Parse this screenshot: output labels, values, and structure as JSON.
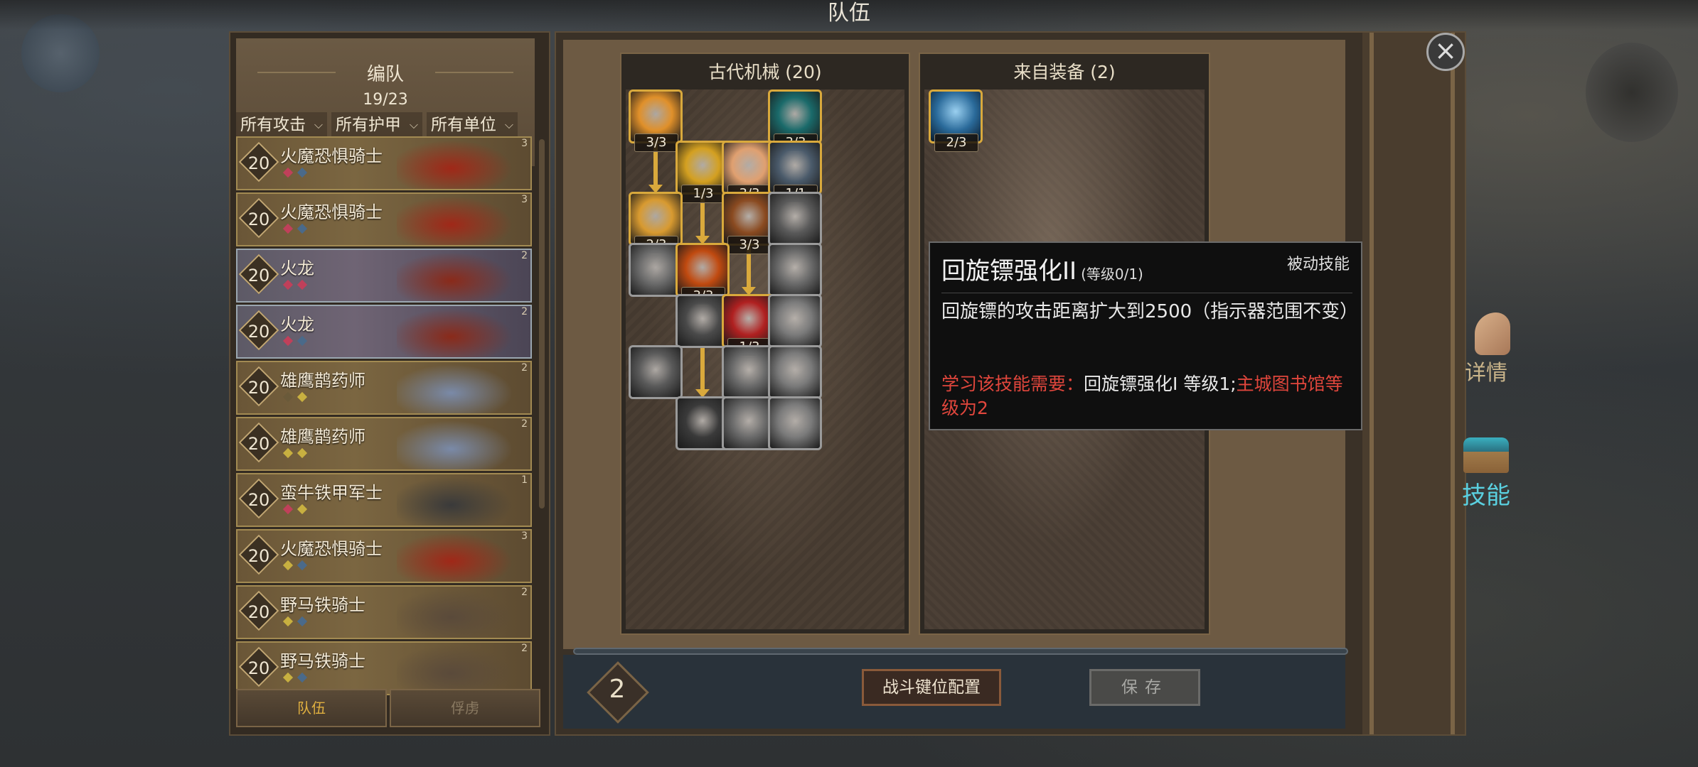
{
  "window_title": "队伍",
  "formation": {
    "title": "编队",
    "count": "19/23",
    "filters": [
      "所有攻击",
      "所有护甲",
      "所有单位"
    ]
  },
  "units": [
    {
      "level": "20",
      "name": "火魔恐惧骑士",
      "count": "3",
      "type": "knight",
      "gems": [
        "#c0405a",
        "#4a6a8a"
      ]
    },
    {
      "level": "20",
      "name": "火魔恐惧骑士",
      "count": "3",
      "type": "knight",
      "gems": [
        "#c0405a",
        "#4a6a8a"
      ]
    },
    {
      "level": "20",
      "name": "火龙",
      "count": "2",
      "type": "dragon",
      "gems": [
        "#c0405a",
        "#c0405a"
      ]
    },
    {
      "level": "20",
      "name": "火龙",
      "count": "2",
      "type": "dragon",
      "gems": [
        "#c0405a",
        "#4a6a8a"
      ]
    },
    {
      "level": "20",
      "name": "雄鹰鹊药师",
      "count": "2",
      "type": "healer",
      "gems": [
        "#6a5a3a",
        "#c8b040"
      ]
    },
    {
      "level": "20",
      "name": "雄鹰鹊药师",
      "count": "2",
      "type": "healer",
      "gems": [
        "#c8b040",
        "#c8b040"
      ]
    },
    {
      "level": "20",
      "name": "蛮牛铁甲军士",
      "count": "1",
      "type": "soldier",
      "gems": [
        "#c0405a",
        "#c8b040"
      ]
    },
    {
      "level": "20",
      "name": "火魔恐惧骑士",
      "count": "3",
      "type": "knight",
      "gems": [
        "#c8b040",
        "#4a6a8a"
      ]
    },
    {
      "level": "20",
      "name": "野马铁骑士",
      "count": "2",
      "type": "rider",
      "gems": [
        "#c8b040",
        "#4a6a8a"
      ]
    },
    {
      "level": "20",
      "name": "野马铁骑士",
      "count": "2",
      "type": "rider",
      "gems": [
        "#c8b040",
        "#4a6a8a"
      ]
    }
  ],
  "bottom_tabs": [
    "队伍",
    "俘虏"
  ],
  "skill_tree": {
    "title": "古代机械 (20)",
    "skills": [
      {
        "id": "missile",
        "level": "3/3",
        "col": 0,
        "row": 0,
        "color": "#e0902a",
        "frame": "gold"
      },
      {
        "id": "vortex",
        "level": "3/3",
        "col": 3,
        "row": 0,
        "color": "#1a6a6a",
        "frame": "gold"
      },
      {
        "id": "golden-gear",
        "level": "1/3",
        "col": 1,
        "row": 1,
        "color": "#d4a020",
        "frame": "gold"
      },
      {
        "id": "caped-hero",
        "level": "3/3",
        "col": 2,
        "row": 1,
        "color": "#e0a070",
        "frame": "gold"
      },
      {
        "id": "boomerang",
        "level": "1/1",
        "col": 3,
        "row": 1,
        "color": "#4a5a6a",
        "frame": "gold"
      },
      {
        "id": "shell-burst",
        "level": "2/3",
        "col": 0,
        "row": 2,
        "color": "#d89a30",
        "frame": "gold"
      },
      {
        "id": "fortress",
        "level": "3/3",
        "col": 2,
        "row": 2,
        "color": "#8a4a20",
        "frame": "gold"
      },
      {
        "id": "grab-hand",
        "level": "",
        "col": 3,
        "row": 2,
        "color": "#5a5a5a",
        "frame": "silver"
      },
      {
        "id": "target-shield",
        "level": "",
        "col": 0,
        "row": 3,
        "color": "#6a6a6a",
        "frame": "silver"
      },
      {
        "id": "crossed-swords",
        "level": "3/3",
        "col": 1,
        "row": 3,
        "color": "#c04a10",
        "frame": "gold"
      },
      {
        "id": "flame-burst",
        "level": "",
        "col": 3,
        "row": 3,
        "color": "#6a6a6a",
        "frame": "silver"
      },
      {
        "id": "spear-thrust",
        "level": "",
        "col": 1,
        "row": 4,
        "color": "#4a4a4a",
        "frame": "silver"
      },
      {
        "id": "triple-arrow",
        "level": "1/3",
        "col": 2,
        "row": 4,
        "color": "#b02020",
        "frame": "gold"
      },
      {
        "id": "feather-strike",
        "level": "",
        "col": 3,
        "row": 4,
        "color": "#7a7a7a",
        "frame": "silver"
      },
      {
        "id": "shield-guard",
        "level": "",
        "col": 0,
        "row": 5,
        "color": "#5a5a5a",
        "frame": "silver"
      },
      {
        "id": "piercing-bolt",
        "level": "",
        "col": 2,
        "row": 5,
        "color": "#6a6a6a",
        "frame": "silver"
      },
      {
        "id": "wind-slash",
        "level": "",
        "col": 3,
        "row": 5,
        "color": "#7a7a7a",
        "frame": "silver"
      },
      {
        "id": "armored-brute",
        "level": "",
        "col": 1,
        "row": 6,
        "color": "#3a3a3a",
        "frame": "silver"
      },
      {
        "id": "arrow-spread",
        "level": "",
        "col": 2,
        "row": 6,
        "color": "#6a6a6a",
        "frame": "silver"
      },
      {
        "id": "blade-rush",
        "level": "",
        "col": 3,
        "row": 6,
        "color": "#7a7a7a",
        "frame": "silver"
      }
    ]
  },
  "equipment": {
    "title": "来自装备 (2)",
    "skills": [
      {
        "id": "spirit-aura",
        "level": "2/3",
        "color": "#2a6a9a",
        "frame": "gold"
      }
    ]
  },
  "side_tabs": {
    "details": "详情",
    "skills": "技能"
  },
  "bottom_bar": {
    "points": "2",
    "keybind_label": "战斗键位配置",
    "save_label": "保存"
  },
  "tooltip": {
    "title": "回旋镖强化II",
    "level": "(等级0/1)",
    "type": "被动技能",
    "description": "回旋镖的攻击距离扩大到2500（指示器范围不变）",
    "req_prefix": "学习该技能需要：",
    "req_skill": "回旋镖强化I 等级1;",
    "req_building": "主城图书馆等级为2"
  },
  "colors": {
    "gold_accent": "#d9a93c",
    "requirement_red": "#e0463c"
  }
}
